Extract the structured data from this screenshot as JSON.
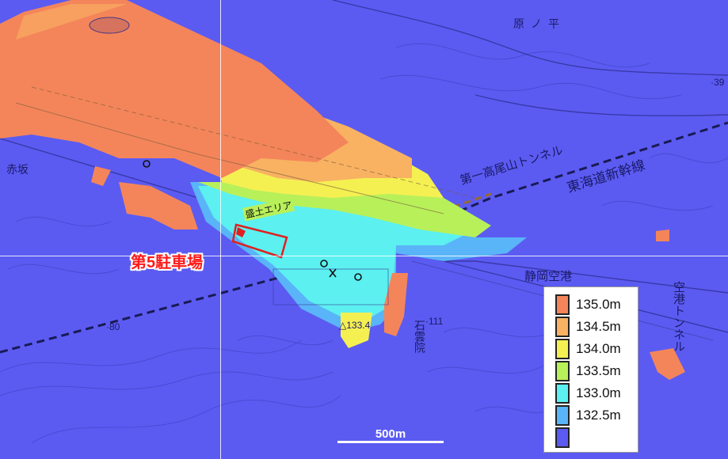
{
  "map": {
    "title": "第5駐車場",
    "fill_area_label": "盛土エリア",
    "scale_label": "500m",
    "place_labels": {
      "akasaka": "赤坂",
      "harunohira": "原ノ平",
      "shizuoka_airport": "静岡空港",
      "airport_tunnel": "空港トンネル",
      "takaoyama_tunnel": "第一高尾山トンネル",
      "tokaido_shinkansen": "東海道新幹線",
      "sekiunin": "石雲院",
      "elev_133_4": "△133.4",
      "elev_111": "·111",
      "elev_80": "·80",
      "elev_39": "·39"
    }
  },
  "legend": {
    "items": [
      {
        "label": "135.0m",
        "color": "#f4855a"
      },
      {
        "label": "134.5m",
        "color": "#f8b262"
      },
      {
        "label": "134.0m",
        "color": "#f5f052"
      },
      {
        "label": "133.5m",
        "color": "#b8f05a"
      },
      {
        "label": "133.0m",
        "color": "#5cf0f0"
      },
      {
        "label": "132.5m",
        "color": "#5ab4f8"
      },
      {
        "label": "",
        "color": "#5b5bf2"
      }
    ]
  },
  "colors": {
    "background": "#5b5bf2",
    "fill_area_outline": "#e02020",
    "title_red": "#ff1a1a"
  }
}
